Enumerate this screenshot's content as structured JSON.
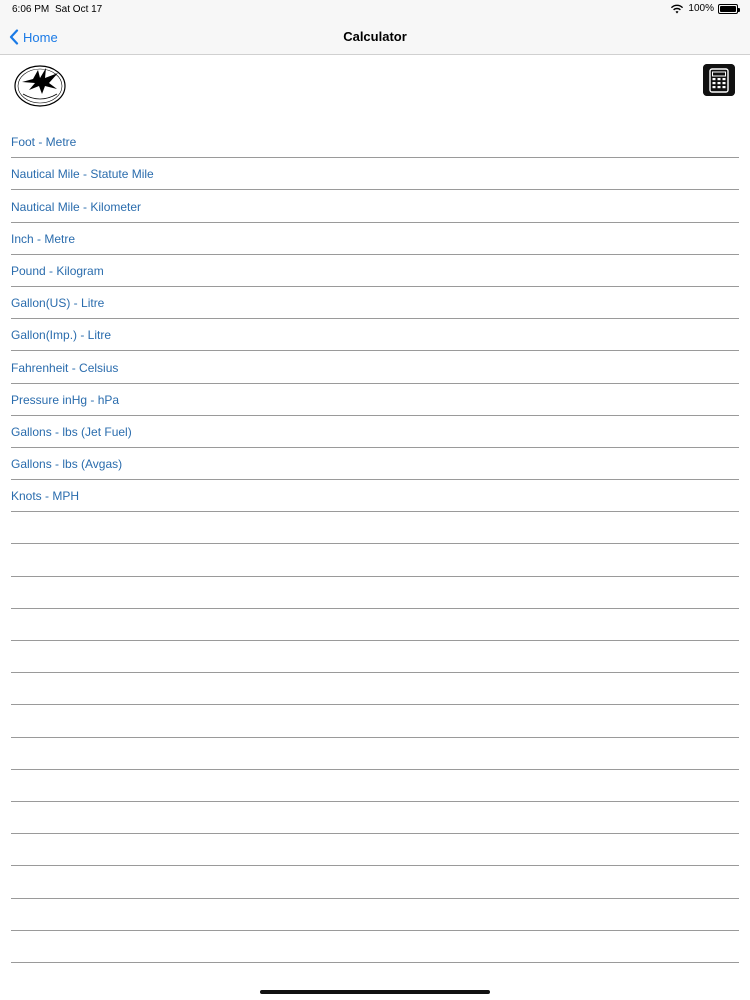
{
  "status_bar": {
    "time": "6:06 PM",
    "date": "Sat Oct 17",
    "battery": "100%"
  },
  "nav": {
    "back_label": "Home",
    "title": "Calculator"
  },
  "icons": {
    "logo": "eagle-logo-icon",
    "calculator": "calculator-icon",
    "back": "chevron-left-icon"
  },
  "colors": {
    "accent": "#1a7ae6",
    "link_text": "#2a6cad",
    "separator": "#9a9a9a"
  },
  "conversions": [
    "Foot - Metre",
    "Nautical Mile - Statute Mile",
    "Nautical Mile - Kilometer",
    "Inch - Metre",
    "Pound - Kilogram",
    "Gallon(US) - Litre",
    "Gallon(Imp.) - Litre",
    "Fahrenheit - Celsius",
    "Pressure inHg - hPa",
    "Gallons - lbs (Jet Fuel)",
    "Gallons - lbs (Avgas)",
    "Knots - MPH"
  ],
  "empty_rows": 14
}
